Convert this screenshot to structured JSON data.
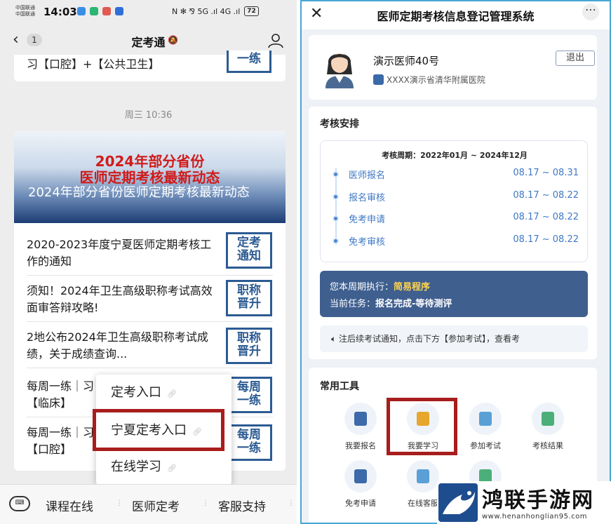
{
  "left_phone": {
    "status": {
      "carrier1": "中国联通",
      "carrier2": "中国联通",
      "time": "14:03",
      "signal": "N ✻ ⅋ 5G .ıl 4G .ıl",
      "battery": "72"
    },
    "nav": {
      "badge": "1",
      "title": "定考通"
    },
    "prev_item_text": "习【口腔】+【公共卫生】",
    "prev_item_thumb": "一练",
    "date_label": "周三 10:36",
    "banner": {
      "red_line1": "2024年部分省份",
      "red_line2": "医师定期考核最新动态",
      "caption": "2024年部分省份医师定期考核最新动态"
    },
    "items": [
      {
        "text": "2020-2023年度宁夏医师定期考核工作的通知",
        "thumb1": "定考",
        "thumb2": "通知"
      },
      {
        "text": "须知！2024年卫生高级职称考试高效面审答辩攻略!",
        "thumb1": "职称",
        "thumb2": "晋升"
      },
      {
        "text": "2地公布2024年卫生高级职称考试成绩，关于成绩查询...",
        "thumb1": "职称",
        "thumb2": "晋升"
      },
      {
        "text": "每周一练｜习【临床】",
        "thumb1": "每周",
        "thumb2": "一练"
      },
      {
        "text": "每周一练｜习【口腔】",
        "thumb1": "每周",
        "thumb2": "一练"
      }
    ],
    "popup": [
      "定考入口",
      "宁夏定考入口",
      "在线学习"
    ],
    "bottom_menu": [
      "课程在线",
      "医师定考",
      "客服支持"
    ]
  },
  "right_phone": {
    "header_title": "医师定期考核信息登记管理系统",
    "profile": {
      "name": "演示医师40号",
      "hospital": "XXXX演示省清华附属医院",
      "logout": "退出"
    },
    "schedule": {
      "title": "考核安排",
      "period": "考核周期：2022年01月 ~ 2024年12月",
      "steps": [
        {
          "name": "医师报名",
          "date": "08.17 ~ 08.31"
        },
        {
          "name": "报名审核",
          "date": "08.17 ~ 08.22"
        },
        {
          "name": "免考申请",
          "date": "08.17 ~ 08.22"
        },
        {
          "name": "免考审核",
          "date": "08.17 ~ 08.22"
        }
      ],
      "exec_label": "您本周期执行：",
      "exec_value": "简易程序",
      "task_label": "当前任务：",
      "task_value": "报名完成-等待测评",
      "notice": "注后续考试通知，点击下方【参加考试】，查看考"
    },
    "tools": {
      "title": "常用工具",
      "items": [
        {
          "label": "我要报名",
          "color": "#3d6aa8"
        },
        {
          "label": "我要学习",
          "color": "#e7a62c"
        },
        {
          "label": "参加考试",
          "color": "#5aa0d6"
        },
        {
          "label": "考核结果",
          "color": "#4caf7a"
        },
        {
          "label": "免考申请",
          "color": "#3d6aa8"
        },
        {
          "label": "在线客服",
          "color": "#5aa0d6"
        },
        {
          "label": "",
          "color": "#4caf7a"
        }
      ]
    }
  },
  "watermark": {
    "name": "鸿联手游网",
    "url": "www.henanhonglian95.com"
  },
  "colors": {
    "thumb_blue": "#2c5b93",
    "highlight_red": "#a81d1d",
    "exec_bg": "#3f5f8f",
    "accent_yellow": "#ffd44d"
  }
}
